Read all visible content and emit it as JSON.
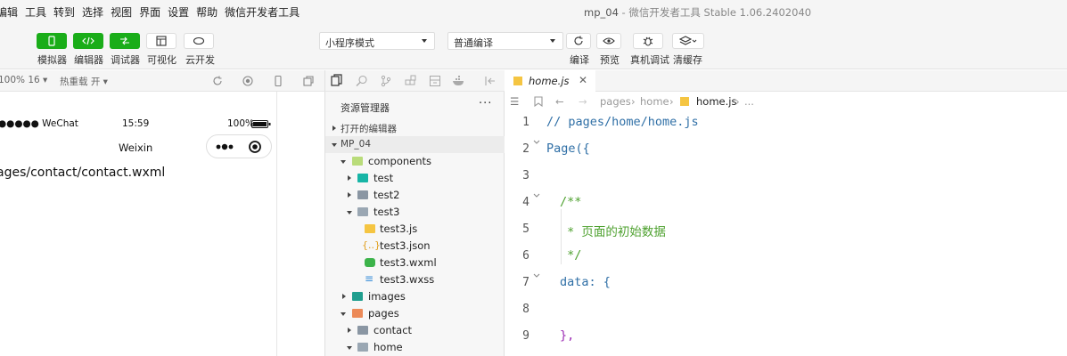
{
  "menu": [
    "编辑",
    "工具",
    "转到",
    "选择",
    "视图",
    "界面",
    "设置",
    "帮助",
    "微信开发者工具"
  ],
  "window_title": {
    "project": "mp_04",
    "app": "微信开发者工具 Stable 1.06.2402040"
  },
  "toolbar": {
    "simulator": "模拟器",
    "editor": "编辑器",
    "debugger": "调试器",
    "visual": "可视化",
    "cloud": "云开发",
    "mode_select": "小程序模式",
    "compile_select": "普通编译",
    "compile": "编译",
    "preview": "预览",
    "remote_debug": "真机调试",
    "clear_cache": "清缓存"
  },
  "simulator": {
    "zoom": "100% 16",
    "hot_reload": "热重载 开",
    "carrier": "●●●●● WeChat",
    "time": "15:59",
    "battery": "100%",
    "nav_title": "Weixin",
    "page_content": "ages/contact/contact.wxml"
  },
  "explorer": {
    "header": "资源管理器",
    "more": "···",
    "open_editors": "打开的编辑器",
    "project_root": "MP_04",
    "tree": [
      {
        "label": "components",
        "type": "folder-open"
      },
      {
        "label": "test",
        "type": "folder"
      },
      {
        "label": "test2",
        "type": "folder"
      },
      {
        "label": "test3",
        "type": "folder-open"
      },
      {
        "label": "test3.js",
        "type": "js"
      },
      {
        "label": "test3.json",
        "type": "json"
      },
      {
        "label": "test3.wxml",
        "type": "wxml"
      },
      {
        "label": "test3.wxss",
        "type": "wxss"
      },
      {
        "label": "images",
        "type": "folder"
      },
      {
        "label": "pages",
        "type": "folder-open"
      },
      {
        "label": "contact",
        "type": "folder"
      },
      {
        "label": "home",
        "type": "folder-open"
      }
    ]
  },
  "editor": {
    "tab_name": "home.js",
    "breadcrumb": [
      "pages",
      "home",
      "home.js",
      "..."
    ],
    "lines": [
      {
        "num": "1",
        "text": "// pages/home/home.js"
      },
      {
        "num": "2",
        "text": "Page({"
      },
      {
        "num": "3",
        "text": ""
      },
      {
        "num": "4",
        "text": "/**"
      },
      {
        "num": "5",
        "text": " * 页面的初始数据"
      },
      {
        "num": "6",
        "text": " */"
      },
      {
        "num": "7",
        "text": "data: {"
      },
      {
        "num": "8",
        "text": ""
      },
      {
        "num": "9",
        "text": "},"
      }
    ]
  },
  "colors": {
    "accent_green": "#1aad19",
    "comment": "#4ea12f",
    "keyword_blue": "#2f6fa6",
    "brace_purple": "#9b2bb3"
  }
}
